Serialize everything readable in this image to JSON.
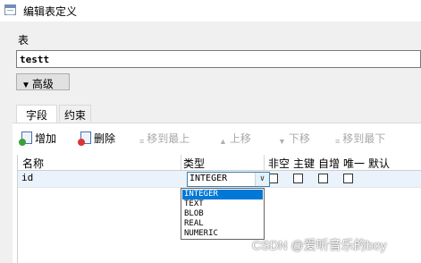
{
  "window": {
    "title": "编辑表定义"
  },
  "table": {
    "section_label": "表",
    "name_value": "testt",
    "advanced_label": "高级"
  },
  "tabs": [
    {
      "label": "字段"
    },
    {
      "label": "约束"
    }
  ],
  "toolbar": {
    "add": "增加",
    "delete": "删除",
    "move_top": "移到最上",
    "move_up": "上移",
    "move_down": "下移",
    "move_bottom": "移到最下"
  },
  "grid": {
    "headers": {
      "name": "名称",
      "type": "类型",
      "not_null": "非空",
      "primary_key": "主键",
      "auto_inc": "自增",
      "unique": "唯一",
      "default": "默认"
    },
    "rows": [
      {
        "name": "id",
        "type": "INTEGER",
        "not_null": false,
        "primary_key": false,
        "auto_inc": false,
        "unique": false
      }
    ]
  },
  "type_dropdown": {
    "options": [
      "INTEGER",
      "TEXT",
      "BLOB",
      "REAL",
      "NUMERIC"
    ],
    "selected_index": 0
  },
  "watermark": "CSDN @爱听音乐的boy"
}
